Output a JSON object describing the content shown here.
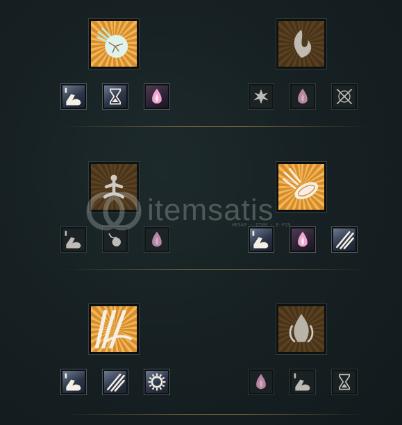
{
  "watermark": {
    "text": "itemsatis",
    "subtext": "HESAP · ITEM · E-PIN"
  },
  "colors": {
    "active_gold": "#e3a13c",
    "locked_gold": "#5d3f1c",
    "background": "#172123",
    "divider": "#be9646"
  },
  "rows": [
    {
      "left": {
        "icon": "shattered-boulder-icon",
        "active": true,
        "modifiers": [
          {
            "icon": "flexed-arm-icon",
            "active": true
          },
          {
            "icon": "hourglass-icon",
            "active": true
          },
          {
            "icon": "pink-flame-icon",
            "active": true
          }
        ]
      },
      "right": {
        "icon": "flame-swirl-icon",
        "active": false,
        "modifiers": [
          {
            "icon": "burst-icon",
            "active": false
          },
          {
            "icon": "pink-flame-icon",
            "active": false
          },
          {
            "icon": "crossed-arrows-icon",
            "active": false
          }
        ]
      }
    },
    {
      "left": {
        "icon": "meditating-figure-icon",
        "active": false,
        "modifiers": [
          {
            "icon": "flexed-arm-icon",
            "active": false
          },
          {
            "icon": "bouncing-orb-icon",
            "active": false
          },
          {
            "icon": "pink-flame-icon",
            "active": false
          }
        ]
      },
      "right": {
        "icon": "meteor-disc-icon",
        "active": true,
        "modifiers": [
          {
            "icon": "flexed-arm-icon",
            "active": true
          },
          {
            "icon": "pink-flame-icon",
            "active": true
          },
          {
            "icon": "claw-slash-icon",
            "active": true
          }
        ]
      }
    },
    {
      "left": {
        "icon": "light-beam-icon",
        "active": true,
        "modifiers": [
          {
            "icon": "flexed-arm-icon",
            "active": true
          },
          {
            "icon": "claw-slash-icon",
            "active": true
          },
          {
            "icon": "sun-gear-icon",
            "active": true
          }
        ]
      },
      "right": {
        "icon": "bonfire-icon",
        "active": false,
        "modifiers": [
          {
            "icon": "pink-flame-icon",
            "active": false
          },
          {
            "icon": "flexed-arm-icon",
            "active": false
          },
          {
            "icon": "hourglass-icon",
            "active": false
          }
        ]
      }
    }
  ]
}
